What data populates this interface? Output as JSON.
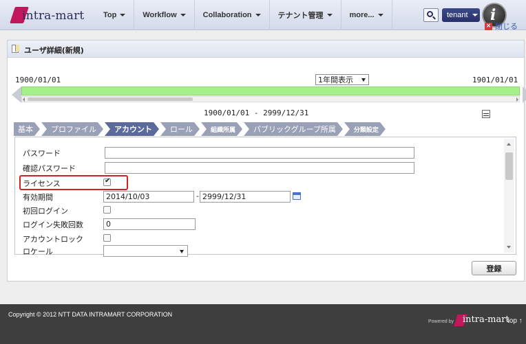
{
  "app": {
    "brand": "intra-mart"
  },
  "nav": {
    "items": [
      {
        "label": "Top"
      },
      {
        "label": "Workflow"
      },
      {
        "label": "Collaboration"
      },
      {
        "label": "テナント管理"
      },
      {
        "label": "more..."
      }
    ],
    "tenant_label": "tenant",
    "avatar_letter": "i"
  },
  "panel": {
    "title": "ユーザ詳細(新規)",
    "close_label": "閉じる"
  },
  "timeline": {
    "start_date": "1900/01/01",
    "end_date": "1901/01/01",
    "range_option": "1年間表示",
    "period": "1900/01/01 - 2999/12/31"
  },
  "tabs": [
    {
      "label": "基本",
      "active": false
    },
    {
      "label": "プロファイル",
      "active": false
    },
    {
      "label": "アカウント",
      "active": true
    },
    {
      "label": "ロール",
      "active": false
    },
    {
      "label": "組織所属",
      "active": false
    },
    {
      "label": "パブリックグループ所属",
      "active": false
    },
    {
      "label": "分類設定",
      "active": false
    }
  ],
  "form": {
    "password_label": "パスワード",
    "password_value": "",
    "confirm_password_label": "確認パスワード",
    "confirm_password_value": "",
    "license_label": "ライセンス",
    "license_checked": true,
    "valid_period_label": "有効期間",
    "valid_from": "2014/10/03",
    "valid_separator": "-",
    "valid_to": "2999/12/31",
    "first_login_label": "初回ログイン",
    "login_fail_label": "ログイン失敗回数",
    "login_fail_required": "*",
    "login_fail_value": "0",
    "account_lock_label": "アカウントロック",
    "locale_label": "ロケール",
    "locale_value": ""
  },
  "actions": {
    "register_label": "登録"
  },
  "footer": {
    "copyright": "Copyright © 2012 NTT DATA INTRAMART CORPORATION",
    "powered_by": "Powered by",
    "brand": "intra-mart",
    "top_link": "top ↑"
  },
  "colors": {
    "navbar": "#d9dfee",
    "tab_active": "#5a6a9a",
    "tab_inactive": "#9aa1b6",
    "timeline_bar": "#a6f28a",
    "highlight_border": "#d32020",
    "footer": "#3e3e3e"
  }
}
